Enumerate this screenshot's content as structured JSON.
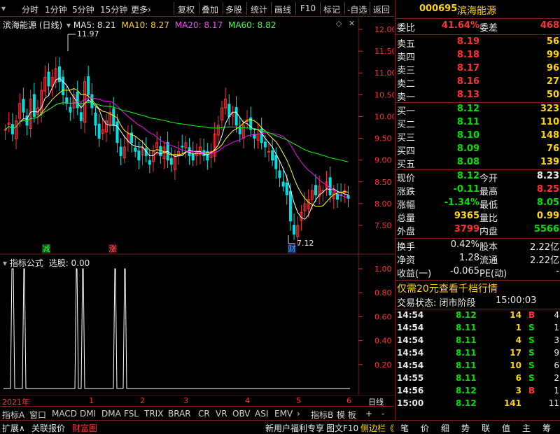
{
  "toolbar": {
    "left": [
      "分时",
      "1分钟",
      "5分钟",
      "15分钟",
      "更多›"
    ],
    "right": [
      "复权",
      "叠加",
      "多股",
      "统计",
      "画线",
      "F10",
      "标记",
      "-自选",
      "返回"
    ]
  },
  "main_chart": {
    "title": "滨海能源 (日线)",
    "ma5": "MA5: 8.21",
    "ma10": "MA10: 8.27",
    "ma20": "MA20: 8.17",
    "ma60": "MA60: 8.82",
    "high_label": "11.97",
    "low_label": "7.12",
    "y_ticks": [
      "12.00",
      "11.50",
      "11.00",
      "10.50",
      "10.00",
      "9.50",
      "9.00",
      "8.50",
      "8.00",
      "7.50"
    ],
    "marker_jian": "减",
    "marker_zhang": "涨",
    "marker_cai": "财"
  },
  "indicator": {
    "title": "指标公式",
    "label": "选股: 0.00",
    "y_ticks": [
      "1.00",
      "0.80",
      "0.60",
      "0.40",
      "0.20"
    ]
  },
  "x_axis": {
    "labels": [
      "2021年",
      "1",
      "2",
      "3",
      "4",
      "5",
      "6"
    ],
    "period": "日线"
  },
  "bottom_tabs": [
    "指标A",
    "窗口",
    "MACD",
    "DMI",
    "DMA",
    "FSL",
    "TRIX",
    "BRAR",
    "CR",
    "VR",
    "OBV",
    "ASI",
    "EMV",
    "›",
    "指标B",
    "模 板",
    "+",
    "-"
  ],
  "status_left": [
    "扩展∧",
    "关联报价",
    "财富圈"
  ],
  "status_right": [
    "新用户福利专享",
    "图文F10",
    "侧边栏《"
  ],
  "right_panel": {
    "code": "000695",
    "name": "滨海能源",
    "weibi_label": "委比",
    "weibi_value": "41.64%",
    "weicha_label": "委差",
    "weicha_value": "468",
    "sells": [
      {
        "label": "卖五",
        "price": "8.19",
        "vol": "56"
      },
      {
        "label": "卖四",
        "price": "8.18",
        "vol": "99"
      },
      {
        "label": "卖三",
        "price": "8.17",
        "vol": "96"
      },
      {
        "label": "卖二",
        "price": "8.16",
        "vol": "27"
      },
      {
        "label": "卖一",
        "price": "8.13",
        "vol": "50"
      }
    ],
    "buys": [
      {
        "label": "买一",
        "price": "8.12",
        "vol": "323"
      },
      {
        "label": "买二",
        "price": "8.11",
        "vol": "110"
      },
      {
        "label": "买三",
        "price": "8.10",
        "vol": "148"
      },
      {
        "label": "买四",
        "price": "8.09",
        "vol": "76"
      },
      {
        "label": "买五",
        "price": "8.08",
        "vol": "139"
      }
    ],
    "quotes": [
      {
        "l1": "现价",
        "v1": "8.12",
        "l2": "今开",
        "v2": "8.23"
      },
      {
        "l1": "涨跌",
        "v1": "-0.11",
        "l2": "最高",
        "v2": "8.25"
      },
      {
        "l1": "涨幅",
        "v1": "-1.34%",
        "l2": "最低",
        "v2": "8.05"
      },
      {
        "l1": "总量",
        "v1": "9365",
        "l2": "量比",
        "v2": "0.99"
      },
      {
        "l1": "外盘",
        "v1": "3799",
        "l2": "内盘",
        "v2": "5566"
      }
    ],
    "stats": [
      {
        "l1": "换手",
        "v1": "0.42%",
        "l2": "股本",
        "v2": "2.22亿"
      },
      {
        "l1": "净资",
        "v1": "1.28",
        "l2": "流通",
        "v2": "2.22亿"
      },
      {
        "l1": "收益(一)",
        "v1": "-0.065",
        "l2": "PE(动)",
        "v2": "-"
      }
    ],
    "promo": "仅需20元查看千档行情",
    "trade_status": "交易状态: 闭市阶段",
    "trade_time": "15:00:03",
    "ticks": [
      {
        "t": "14:54",
        "p": "8.12",
        "v": "14",
        "d": "B",
        "n": "4"
      },
      {
        "t": "14:54",
        "p": "8.11",
        "v": "1",
        "d": "S",
        "n": "1"
      },
      {
        "t": "14:54",
        "p": "8.11",
        "v": "4",
        "d": "S",
        "n": "3"
      },
      {
        "t": "14:54",
        "p": "8.11",
        "v": "17",
        "d": "S",
        "n": "9"
      },
      {
        "t": "14:54",
        "p": "8.11",
        "v": "10",
        "d": "S",
        "n": "6"
      },
      {
        "t": "14:55",
        "p": "8.11",
        "v": "6",
        "d": "S",
        "n": "2"
      },
      {
        "t": "14:56",
        "p": "8.12",
        "v": "3",
        "d": "B",
        "n": "1"
      },
      {
        "t": "15:00",
        "p": "8.12",
        "v": "141",
        "d": "",
        "n": "11"
      }
    ],
    "bottom_tabs": [
      "笔",
      "价",
      "细",
      "势",
      "联",
      "值",
      "主",
      "筹"
    ]
  },
  "colors": {
    "up": "#ff3030",
    "down": "#00e0e0",
    "ma5": "#ffffff",
    "ma10": "#ffff00",
    "ma20": "#ff00ff",
    "ma60": "#00ff00"
  }
}
